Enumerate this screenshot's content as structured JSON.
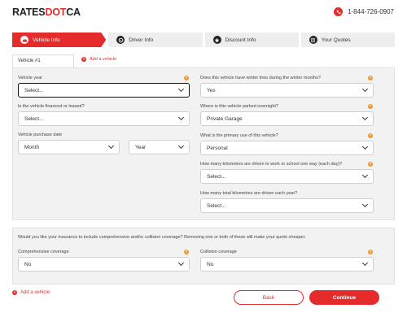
{
  "header": {
    "logo_text_1": "RATES",
    "logo_text_2": "DOT",
    "logo_text_3": "CA",
    "phone": "1-844-726-0907"
  },
  "steps": [
    {
      "label": "Vehicle Info",
      "icon": "car-icon",
      "active": true
    },
    {
      "label": "Driver Info",
      "icon": "driver-icon",
      "active": false
    },
    {
      "label": "Discount Info",
      "icon": "star-icon",
      "active": false
    },
    {
      "label": "Your Quotes",
      "icon": "quotes-icon",
      "active": false
    }
  ],
  "vehicle_tab": "Vehicle #1",
  "add_vehicle_top": "Add a vehicle",
  "left_fields": {
    "year_label": "Vehicle year",
    "year_value": "Select...",
    "financed_label": "Is the vehicle financed or leased?",
    "financed_value": "Select...",
    "purchase_label": "Vehicle purchase date",
    "month_value": "Month",
    "year2_value": "Year"
  },
  "right_fields": {
    "winter_label": "Does this vehicle have winter tires during the winter months?",
    "winter_value": "Yes",
    "parked_label": "Where is this vehicle parked overnight?",
    "parked_value": "Private Garage",
    "use_label": "What is the primary use of this vehicle?",
    "use_value": "Personal",
    "km_work_label": "How many kilometres are driven to work or school one way (each day)?",
    "km_work_value": "Select...",
    "km_total_label": "How many total kilometres are driven each year?",
    "km_total_value": "Select..."
  },
  "coverage": {
    "info": "Would you like your insurance to include comprehensive and/or collision coverage? Removing one or both of these will make your quote cheaper.",
    "comp_label": "Comprehensive coverage",
    "comp_value": "No",
    "coll_label": "Collision coverage",
    "coll_value": "No"
  },
  "footer": {
    "add_vehicle": "Add a vehicle",
    "back": "Back",
    "continue": "Continue"
  },
  "colors": {
    "accent": "#e52b2b",
    "help": "#f0962a"
  }
}
